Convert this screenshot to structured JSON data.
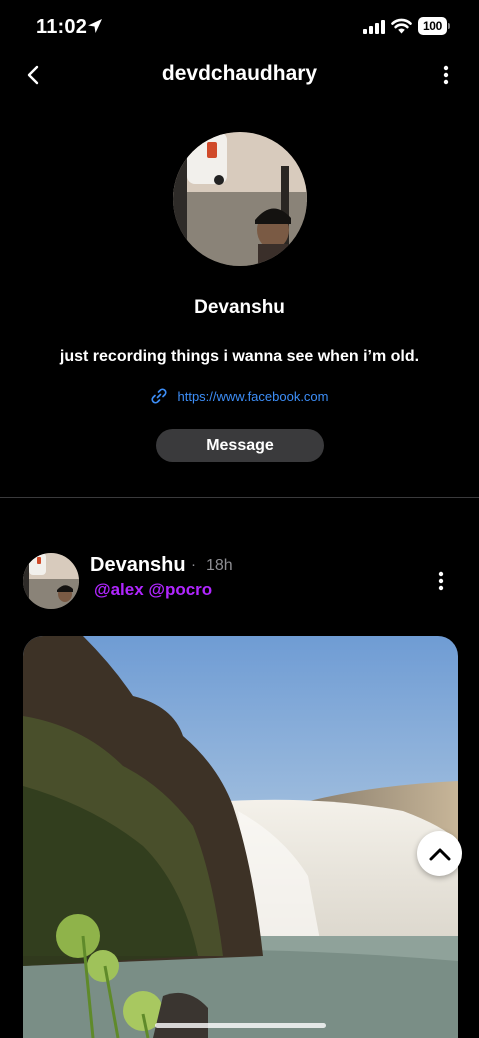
{
  "status_bar": {
    "time": "11:02",
    "battery": "100",
    "icons": [
      "location-arrow-icon",
      "signal-icon",
      "wifi-icon",
      "battery-icon"
    ]
  },
  "nav": {
    "title": "devdchaudhary",
    "back_icon": "chevron-left-icon",
    "menu_icon": "more-vertical-icon"
  },
  "profile": {
    "display_name": "Devanshu",
    "bio": "just recording things i wanna see when i’m old.",
    "link": "https://www.facebook.com",
    "link_icon": "link-icon",
    "message_label": "Message"
  },
  "post": {
    "author": "Devanshu",
    "separator": "·",
    "time": "18h",
    "mentions": "@alex @pocro",
    "menu_icon": "more-vertical-icon",
    "scroll_icon": "chevron-up-icon"
  },
  "colors": {
    "background": "#000000",
    "link": "#3d8ef7",
    "mention": "#b026ff",
    "button": "#3a3a3c",
    "muted": "#8e8e93"
  }
}
